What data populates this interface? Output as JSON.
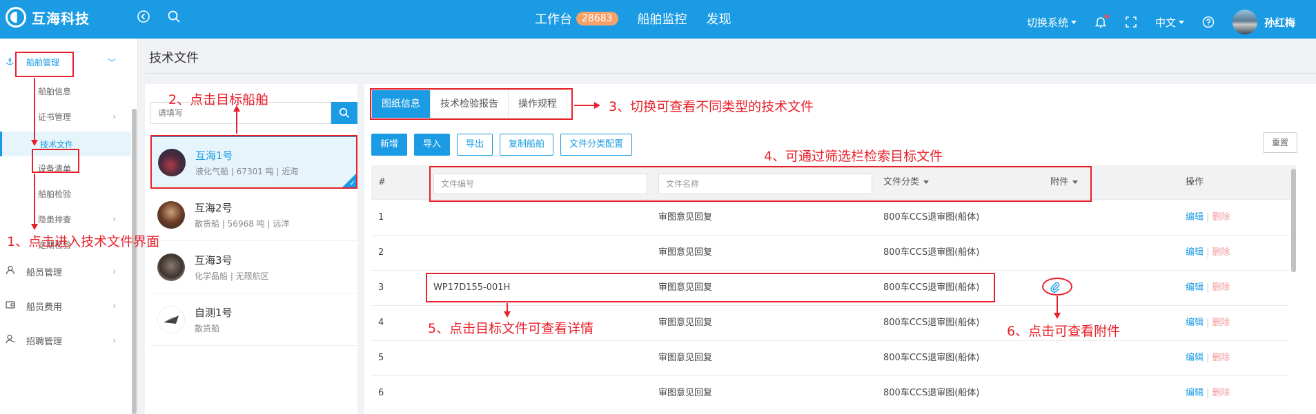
{
  "header": {
    "brand": "互海科技",
    "nav": [
      {
        "label": "工作台",
        "badge": "28683"
      },
      {
        "label": "船舶监控"
      },
      {
        "label": "发现"
      }
    ],
    "switch_system": "切换系统",
    "language": "中文",
    "username": "孙红梅"
  },
  "sidebar": {
    "top_group": "船舶管理",
    "sub_items": [
      "船舶信息",
      "证书管理",
      "技术文件",
      "设备清单",
      "船舶检验",
      "隐患排查",
      "定期检验"
    ],
    "groups": [
      "船员管理",
      "船员费用",
      "招聘管理"
    ]
  },
  "page": {
    "title": "技术文件"
  },
  "ship_list": {
    "search_placeholder": "请填写",
    "ships": [
      {
        "name": "互海1号",
        "desc": "液化气船 | 67301 吨 | 近海"
      },
      {
        "name": "互海2号",
        "desc": "散货船 | 56968 吨 | 远洋"
      },
      {
        "name": "互海3号",
        "desc": "化学品船 | 无限航区"
      },
      {
        "name": "自测1号",
        "desc": "散货船"
      }
    ]
  },
  "tabs": [
    "图纸信息",
    "技术检验报告",
    "操作规程"
  ],
  "toolbar": {
    "add": "新增",
    "import": "导入",
    "export": "导出",
    "copy": "复制船舶",
    "config": "文件分类配置",
    "reset": "重置"
  },
  "table": {
    "col_index": "#",
    "filter_code_placeholder": "文件编号",
    "filter_name_placeholder": "文件名称",
    "col_category": "文件分类",
    "col_attachment": "附件",
    "col_action": "操作",
    "edit_label": "编辑",
    "delete_label": "删除",
    "rows": [
      {
        "index": "1",
        "code": "",
        "name": "审图意见回复",
        "category": "800车CCS退审图(船体)"
      },
      {
        "index": "2",
        "code": "",
        "name": "审图意见回复",
        "category": "800车CCS退审图(船体)"
      },
      {
        "index": "3",
        "code": "WP17D155-001H",
        "name": "审图意见回复",
        "category": "800车CCS退审图(船体)"
      },
      {
        "index": "4",
        "code": "",
        "name": "审图意见回复",
        "category": "800车CCS退审图(船体)"
      },
      {
        "index": "5",
        "code": "",
        "name": "审图意见回复",
        "category": "800车CCS退审图(船体)"
      },
      {
        "index": "6",
        "code": "",
        "name": "审图意见回复",
        "category": "800车CCS退审图(船体)"
      }
    ]
  },
  "annotations": {
    "a1": "1、点击进入技术文件界面",
    "a2": "2、点击目标船舶",
    "a3": "3、切换可查看不同类型的技术文件",
    "a4": "4、可通过筛选栏检索目标文件",
    "a5": "5、点击目标文件可查看详情",
    "a6": "6、点击可查看附件"
  },
  "colors": {
    "primary": "#1a9be3",
    "annotation": "#e8202a"
  }
}
